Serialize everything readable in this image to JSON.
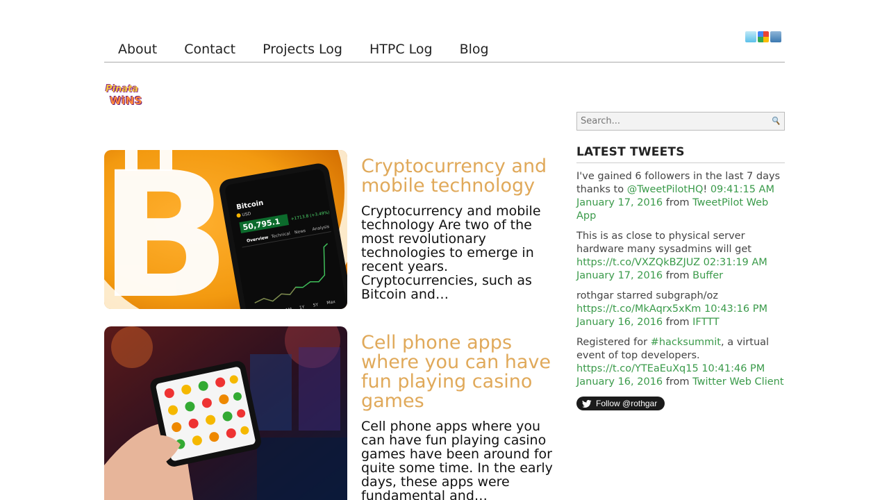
{
  "social": [
    "twitter-icon",
    "google-plus-icon",
    "linkedin-icon"
  ],
  "nav": [
    {
      "label": "About"
    },
    {
      "label": "Contact"
    },
    {
      "label": "Projects Log"
    },
    {
      "label": "HTPC Log"
    },
    {
      "label": "Blog"
    }
  ],
  "logo": {
    "line1": "Pinata",
    "line2": "WiNS"
  },
  "posts": [
    {
      "title": "Cryptocurrency and mobile technology",
      "excerpt": "Cryptocurrency and mobile technology Are two of the most revolutionary technologies to emerge in recent years. Cryptocurrencies, such as Bitcoin and…",
      "thumb": {
        "phone_title": "Bitcoin",
        "phone_sub": "USD",
        "price": "50,795.1",
        "change": "+1713.8 (+3.49%)",
        "tabs": [
          "Overview",
          "Technical",
          "News",
          "Analysis"
        ],
        "ranges": [
          "1D",
          "1W",
          "1M",
          "1Y",
          "5Y",
          "Max"
        ]
      }
    },
    {
      "title": "Cell phone apps where you can have fun playing casino games",
      "excerpt": "Cell phone apps where you can have fun playing casino games have been around for quite some time. In the early days, these apps were fundamental and…"
    }
  ],
  "search": {
    "placeholder": "Search..."
  },
  "tweets_heading": "LATEST TWEETS",
  "tweets": [
    {
      "text": "I've gained 6 followers in the last 7 days thanks to ",
      "mention": "@TweetPilotHQ",
      "after": "!",
      "time": "09:41:15 AM January 17, 2016",
      "from": "from",
      "source": "TweetPilot Web App"
    },
    {
      "text": "This is as close to physical server hardware many sysadmins will get ",
      "link": "https://t.co/VXZQkBZJUZ",
      "time": "02:31:19 AM January 17, 2016",
      "from": "from",
      "source": "Buffer"
    },
    {
      "text": "rothgar starred subgraph/oz ",
      "link": "https://t.co/MkAqrx5xKm",
      "time": "10:43:16 PM January 16, 2016",
      "from": "from",
      "source": "IFTTT"
    },
    {
      "text": "Registered for ",
      "hashtag": "#hacksummit",
      "after": ", a virtual event of top developers. ",
      "link": "https://t.co/YTEaEuXq15",
      "time": "10:41:46 PM January 16, 2016",
      "from": "from",
      "source": "Twitter Web Client"
    }
  ],
  "follow_button": "Follow @rothgar"
}
